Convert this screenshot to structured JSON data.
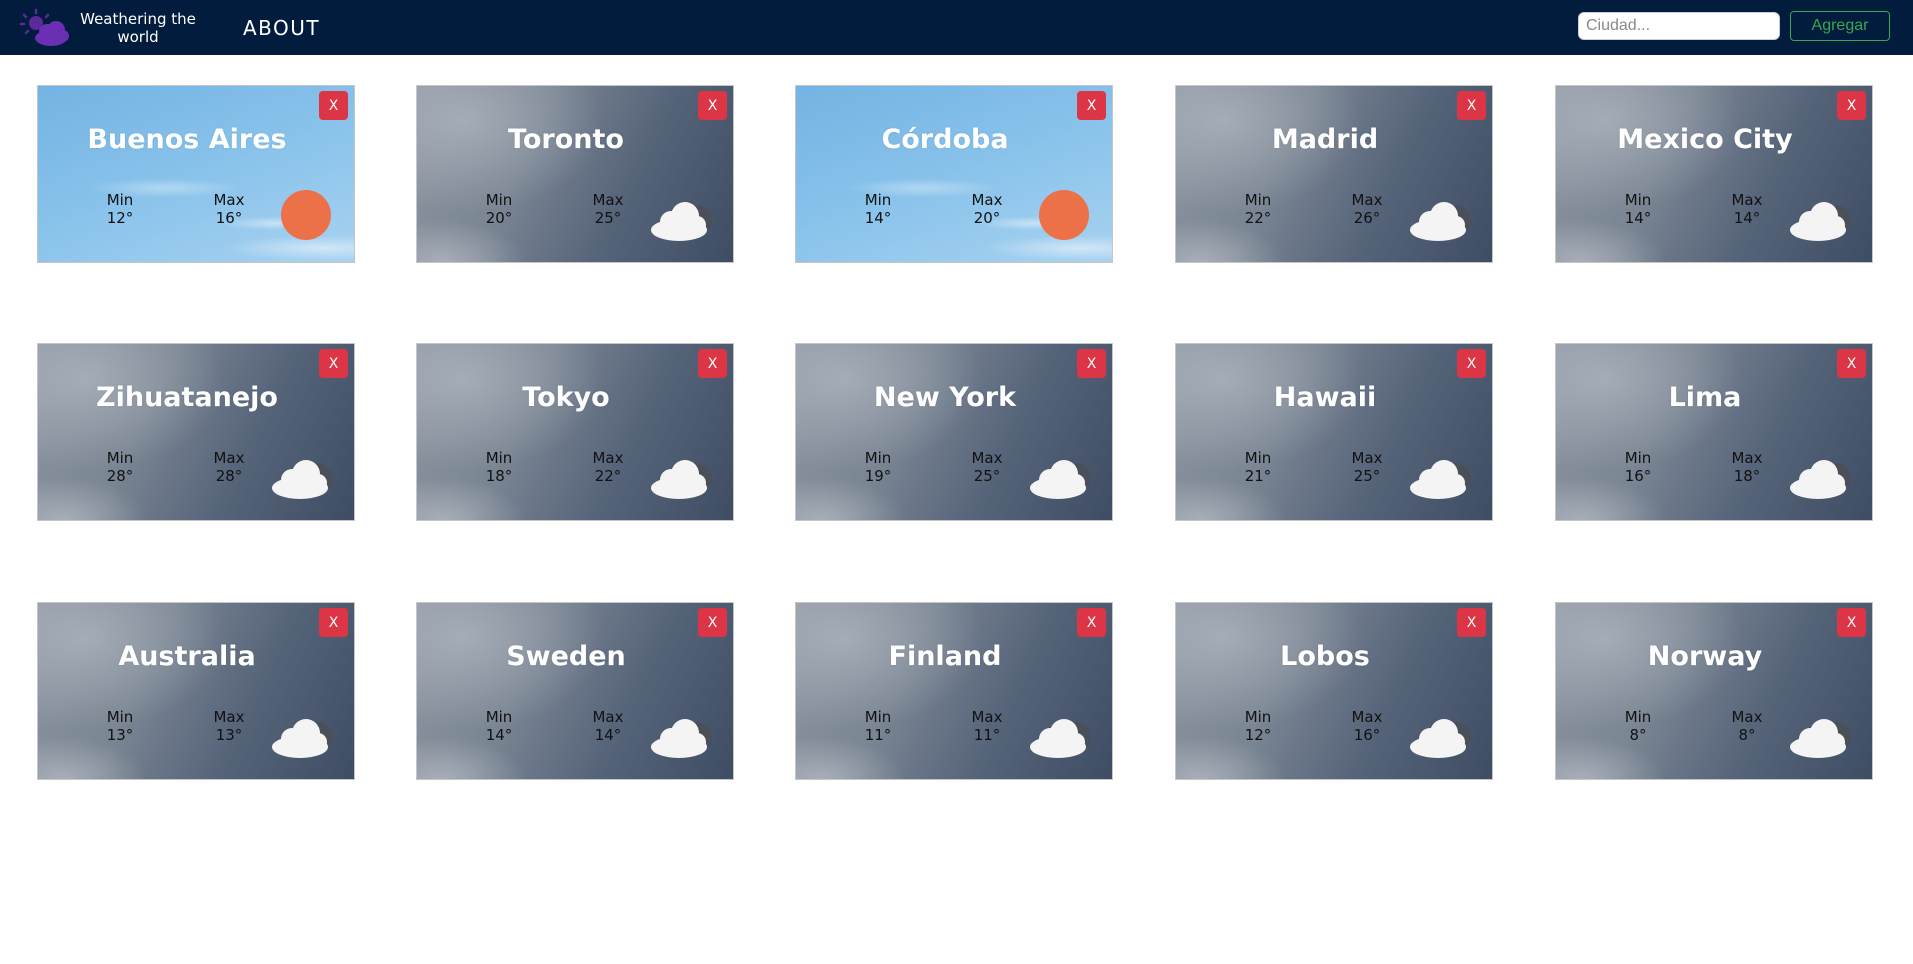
{
  "header": {
    "brand_line1": "Weathering the",
    "brand_line2": "world",
    "nav_about": "ABOUT",
    "search_placeholder": "Ciudad...",
    "add_label": "Agregar"
  },
  "colors": {
    "navbar": "#011c3c",
    "close_button": "#dc3545",
    "add_button": "#34a853",
    "sun": "#ec7048"
  },
  "degree_symbol": "°",
  "card_labels": {
    "min": "Min",
    "max": "Max",
    "close": "X"
  },
  "cities": [
    {
      "name": "Buenos Aires",
      "min": "12°",
      "max": "16°",
      "icon": "sun-icon"
    },
    {
      "name": "Toronto",
      "min": "20°",
      "max": "25°",
      "icon": "cloud-icon"
    },
    {
      "name": "Córdoba",
      "min": "14°",
      "max": "20°",
      "icon": "sun-icon"
    },
    {
      "name": "Madrid",
      "min": "22°",
      "max": "26°",
      "icon": "cloud-icon"
    },
    {
      "name": "Mexico City",
      "min": "14°",
      "max": "14°",
      "icon": "cloud-icon"
    },
    {
      "name": "Zihuatanejo",
      "min": "28°",
      "max": "28°",
      "icon": "cloud-icon"
    },
    {
      "name": "Tokyo",
      "min": "18°",
      "max": "22°",
      "icon": "cloud-icon"
    },
    {
      "name": "New York",
      "min": "19°",
      "max": "25°",
      "icon": "cloud-icon"
    },
    {
      "name": "Hawaii",
      "min": "21°",
      "max": "25°",
      "icon": "cloud-icon"
    },
    {
      "name": "Lima",
      "min": "16°",
      "max": "18°",
      "icon": "cloud-icon"
    },
    {
      "name": "Australia",
      "min": "13°",
      "max": "13°",
      "icon": "cloud-icon"
    },
    {
      "name": "Sweden",
      "min": "14°",
      "max": "14°",
      "icon": "cloud-icon"
    },
    {
      "name": "Finland",
      "min": "11°",
      "max": "11°",
      "icon": "cloud-icon"
    },
    {
      "name": "Lobos",
      "min": "12°",
      "max": "16°",
      "icon": "cloud-icon"
    },
    {
      "name": "Norway",
      "min": "8°",
      "max": "8°",
      "icon": "cloud-icon"
    }
  ]
}
